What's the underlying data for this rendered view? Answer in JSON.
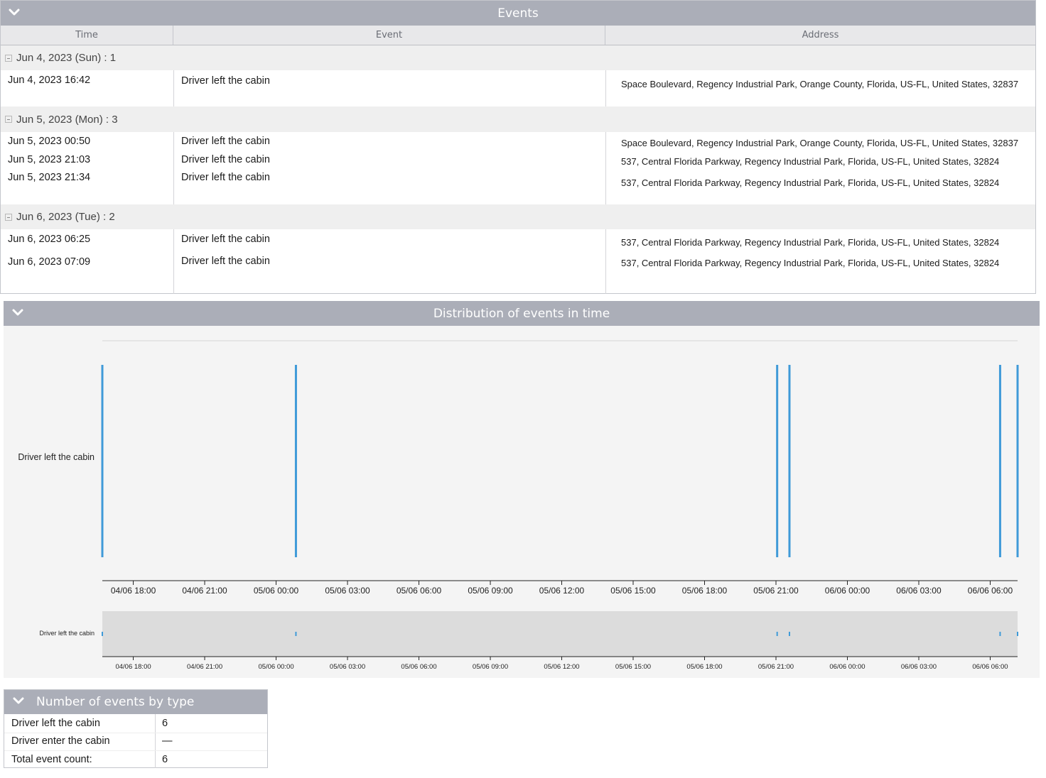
{
  "events_panel": {
    "title": "Events",
    "columns": [
      "Time",
      "Event",
      "Address"
    ],
    "groups": [
      {
        "label": "Jun 4, 2023 (Sun) : 1",
        "rows": [
          {
            "time": "Jun 4, 2023 16:42",
            "event": "Driver left the cabin",
            "address": "Space Boulevard, Regency Industrial Park, Orange County, Florida, US-FL, United States, 32837"
          }
        ]
      },
      {
        "label": "Jun 5, 2023 (Mon) : 3",
        "rows": [
          {
            "time": "Jun 5, 2023 00:50",
            "event": "Driver left the cabin",
            "address": "Space Boulevard, Regency Industrial Park, Orange County, Florida, US-FL, United States, 32837"
          },
          {
            "time": "Jun 5, 2023 21:03",
            "event": "Driver left the cabin",
            "address": "537, Central Florida Parkway, Regency Industrial Park, Florida, US-FL, United States, 32824"
          },
          {
            "time": "Jun 5, 2023 21:34",
            "event": "Driver left the cabin",
            "address": "537, Central Florida Parkway, Regency Industrial Park, Florida, US-FL, United States, 32824"
          }
        ]
      },
      {
        "label": "Jun 6, 2023 (Tue) : 2",
        "rows": [
          {
            "time": "Jun 6, 2023 06:25",
            "event": "Driver left the cabin",
            "address": "537, Central Florida Parkway, Regency Industrial Park, Florida, US-FL, United States, 32824"
          },
          {
            "time": "Jun 6, 2023 07:09",
            "event": "Driver left the cabin",
            "address": "537, Central Florida Parkway, Regency Industrial Park, Florida, US-FL, United States, 32824"
          }
        ]
      }
    ]
  },
  "distribution_panel": {
    "title": "Distribution of events in time"
  },
  "chart_data": {
    "type": "scatter",
    "title": "",
    "xlabel": "",
    "ylabel": "",
    "y_categories": [
      "Driver left the cabin"
    ],
    "x_range": [
      "2023-06-04 16:42",
      "2023-06-06 07:09"
    ],
    "x_ticks": [
      "04/06 18:00",
      "04/06 21:00",
      "05/06 00:00",
      "05/06 03:00",
      "05/06 06:00",
      "05/06 09:00",
      "05/06 12:00",
      "05/06 15:00",
      "05/06 18:00",
      "05/06 21:00",
      "06/06 00:00",
      "06/06 03:00",
      "06/06 06:00"
    ],
    "series": [
      {
        "name": "Driver left the cabin",
        "x": [
          "2023-06-04 16:42",
          "2023-06-05 00:50",
          "2023-06-05 21:03",
          "2023-06-05 21:34",
          "2023-06-06 06:25",
          "2023-06-06 07:09"
        ]
      }
    ],
    "navigator": true,
    "color": "#3f9ad8"
  },
  "count_panel": {
    "title": "Number of events by type",
    "rows": [
      {
        "label": "Driver left the cabin",
        "value": "6"
      },
      {
        "label": "Driver enter the cabin",
        "value": "—"
      },
      {
        "label": "Total event count:",
        "value": "6"
      }
    ]
  },
  "colors": {
    "header_bg": "#abaeb8",
    "event_bar": "#3f9ad8",
    "group_bg": "#efefef"
  }
}
